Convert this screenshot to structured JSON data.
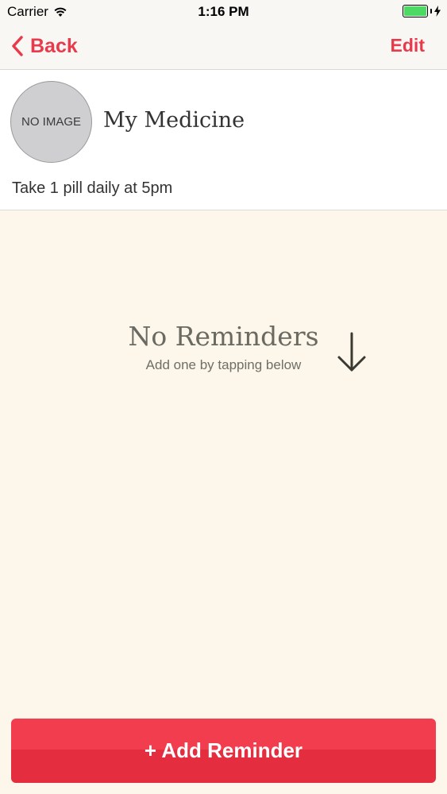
{
  "status_bar": {
    "carrier": "Carrier",
    "time": "1:16 PM",
    "battery_level": 1.0,
    "battery_color": "#4cd964"
  },
  "nav": {
    "back_label": "Back",
    "edit_label": "Edit",
    "accent_color": "#e83a4a"
  },
  "medicine": {
    "image_placeholder": "NO IMAGE",
    "name": "My Medicine",
    "schedule": "Take 1 pill daily at 5pm"
  },
  "empty_state": {
    "title": "No Reminders",
    "subtitle": "Add one by tapping below",
    "icon": "arrow-down-icon"
  },
  "footer": {
    "add_button_label": "+ Add Reminder",
    "button_color": "#f13d4d"
  }
}
